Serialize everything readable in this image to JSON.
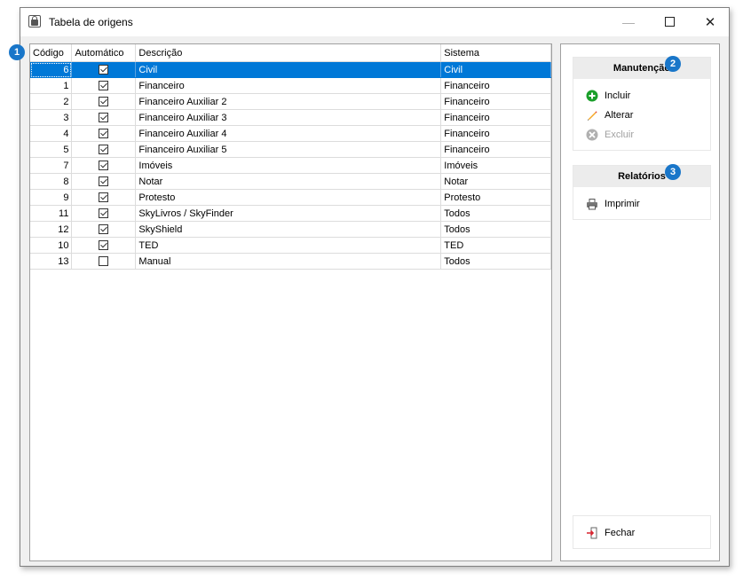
{
  "window": {
    "title": "Tabela de origens"
  },
  "grid": {
    "columns": {
      "codigo": "Código",
      "automatico": "Automático",
      "descricao": "Descrição",
      "sistema": "Sistema"
    },
    "rows": [
      {
        "codigo": "6",
        "automatico": true,
        "descricao": "Civil",
        "sistema": "Civil",
        "selected": true
      },
      {
        "codigo": "1",
        "automatico": true,
        "descricao": "Financeiro",
        "sistema": "Financeiro"
      },
      {
        "codigo": "2",
        "automatico": true,
        "descricao": "Financeiro Auxiliar 2",
        "sistema": "Financeiro"
      },
      {
        "codigo": "3",
        "automatico": true,
        "descricao": "Financeiro Auxiliar 3",
        "sistema": "Financeiro"
      },
      {
        "codigo": "4",
        "automatico": true,
        "descricao": "Financeiro Auxiliar 4",
        "sistema": "Financeiro"
      },
      {
        "codigo": "5",
        "automatico": true,
        "descricao": "Financeiro Auxiliar 5",
        "sistema": "Financeiro"
      },
      {
        "codigo": "7",
        "automatico": true,
        "descricao": "Imóveis",
        "sistema": "Imóveis"
      },
      {
        "codigo": "8",
        "automatico": true,
        "descricao": "Notar",
        "sistema": "Notar"
      },
      {
        "codigo": "9",
        "automatico": true,
        "descricao": "Protesto",
        "sistema": "Protesto"
      },
      {
        "codigo": "11",
        "automatico": true,
        "descricao": "SkyLivros / SkyFinder",
        "sistema": "Todos"
      },
      {
        "codigo": "12",
        "automatico": true,
        "descricao": "SkyShield",
        "sistema": "Todos"
      },
      {
        "codigo": "10",
        "automatico": true,
        "descricao": "TED",
        "sistema": "TED"
      },
      {
        "codigo": "13",
        "automatico": false,
        "descricao": "Manual",
        "sistema": "Todos"
      }
    ]
  },
  "manutencao": {
    "title": "Manutenção",
    "incluir": "Incluir",
    "alterar": "Alterar",
    "excluir": "Excluir"
  },
  "relatorios": {
    "title": "Relatórios",
    "imprimir": "Imprimir"
  },
  "fechar": "Fechar",
  "badges": {
    "grid": "1",
    "manutencao": "2",
    "relatorios": "3"
  },
  "colors": {
    "selection": "#0078d7",
    "badge": "#1976c9",
    "incluir": "#1a9f2a",
    "excluir": "#b0b0b0",
    "fechar": "#d9232e"
  }
}
